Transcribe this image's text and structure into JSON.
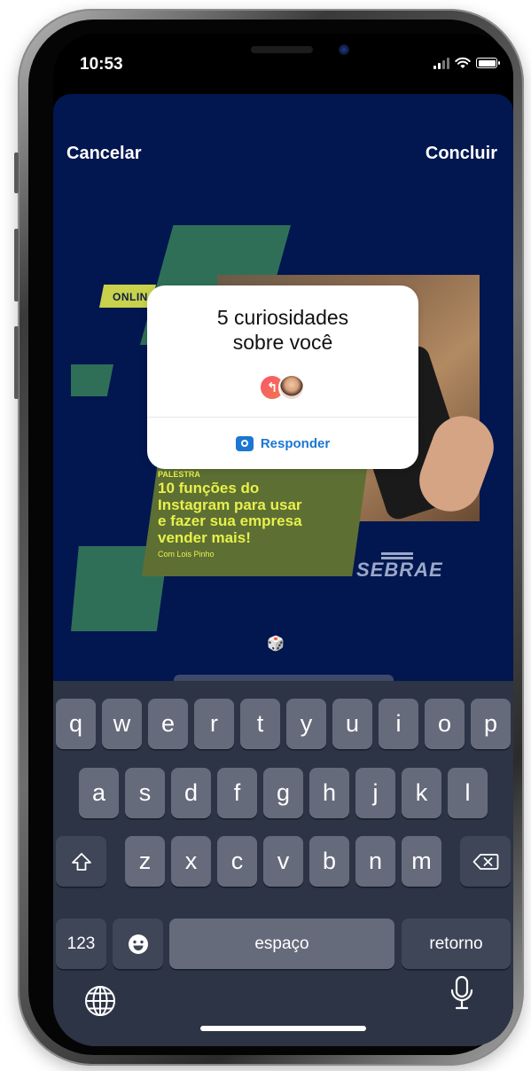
{
  "status_bar": {
    "time": "10:53",
    "battery_level": 1.0
  },
  "nav": {
    "cancel_label": "Cancelar",
    "done_label": "Concluir"
  },
  "post": {
    "tag": "ONLIN",
    "kicker": "PALESTRA",
    "title_lines": [
      "10 funções do",
      "Instagram para usar",
      "e fazer sua empresa",
      "vender mais!"
    ],
    "author": "Com Lois Pinho",
    "brand": "SEBRAE"
  },
  "sticker": {
    "title_line1": "5 curiosidades",
    "title_line2": "sobre você",
    "reply_label": "Responder",
    "accent_color": "#1a77d2"
  },
  "keyboard": {
    "row1": [
      "q",
      "w",
      "e",
      "r",
      "t",
      "y",
      "u",
      "i",
      "o",
      "p"
    ],
    "row2": [
      "a",
      "s",
      "d",
      "f",
      "g",
      "h",
      "j",
      "k",
      "l"
    ],
    "row3": [
      "z",
      "x",
      "c",
      "v",
      "b",
      "n",
      "m"
    ],
    "numbers_label": "123",
    "space_label": "espaço",
    "return_label": "retorno"
  },
  "icons": [
    "shift-icon",
    "backspace-icon",
    "emoji-icon",
    "globe-icon",
    "mic-icon",
    "camera-icon",
    "dice-icon",
    "signal-icon",
    "wifi-icon",
    "battery-icon"
  ]
}
